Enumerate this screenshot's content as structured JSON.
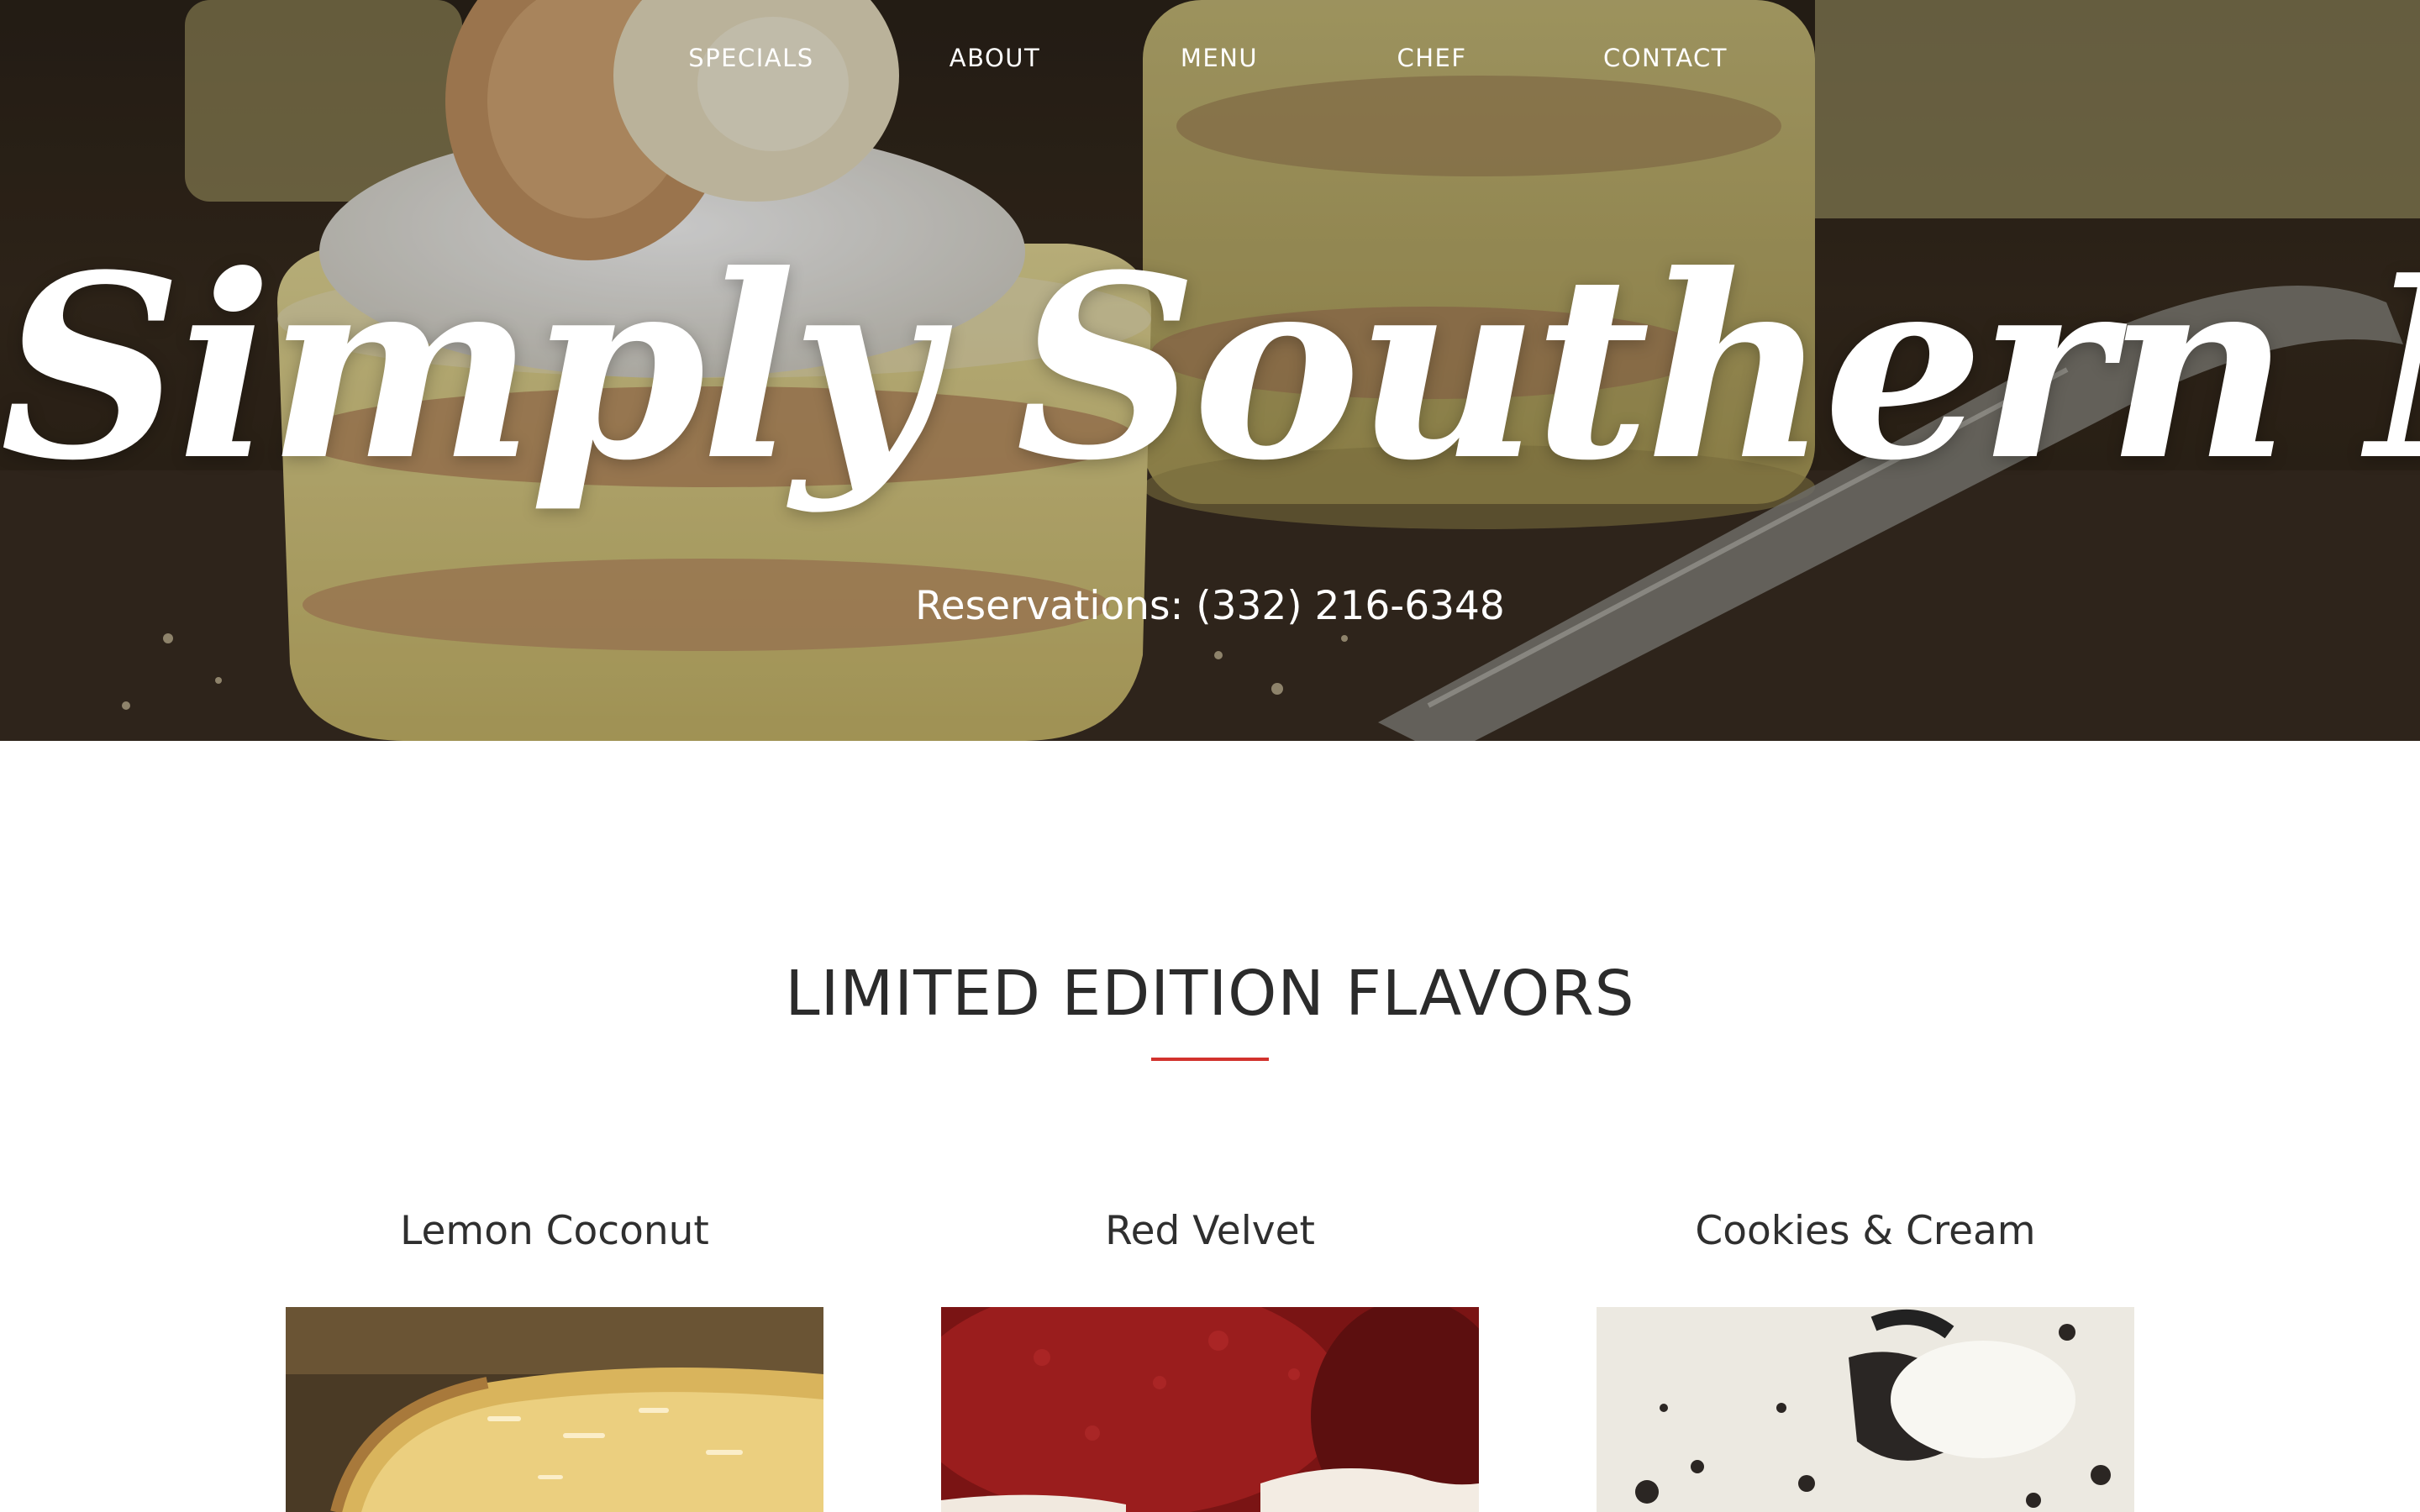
{
  "nav": {
    "items": [
      {
        "label": "SPECIALS"
      },
      {
        "label": "ABOUT"
      },
      {
        "label": "MENU"
      },
      {
        "label": "CHEF"
      },
      {
        "label": "CONTACT"
      }
    ]
  },
  "hero": {
    "brand": "Simply Southern NYC",
    "reservations": "Reservations: (332) 216-6348"
  },
  "flavors": {
    "title": "LIMITED EDITION FLAVORS",
    "accent_color": "#d2322d",
    "items": [
      {
        "name": "Lemon Coconut"
      },
      {
        "name": "Red Velvet"
      },
      {
        "name": "Cookies & Cream"
      }
    ]
  }
}
